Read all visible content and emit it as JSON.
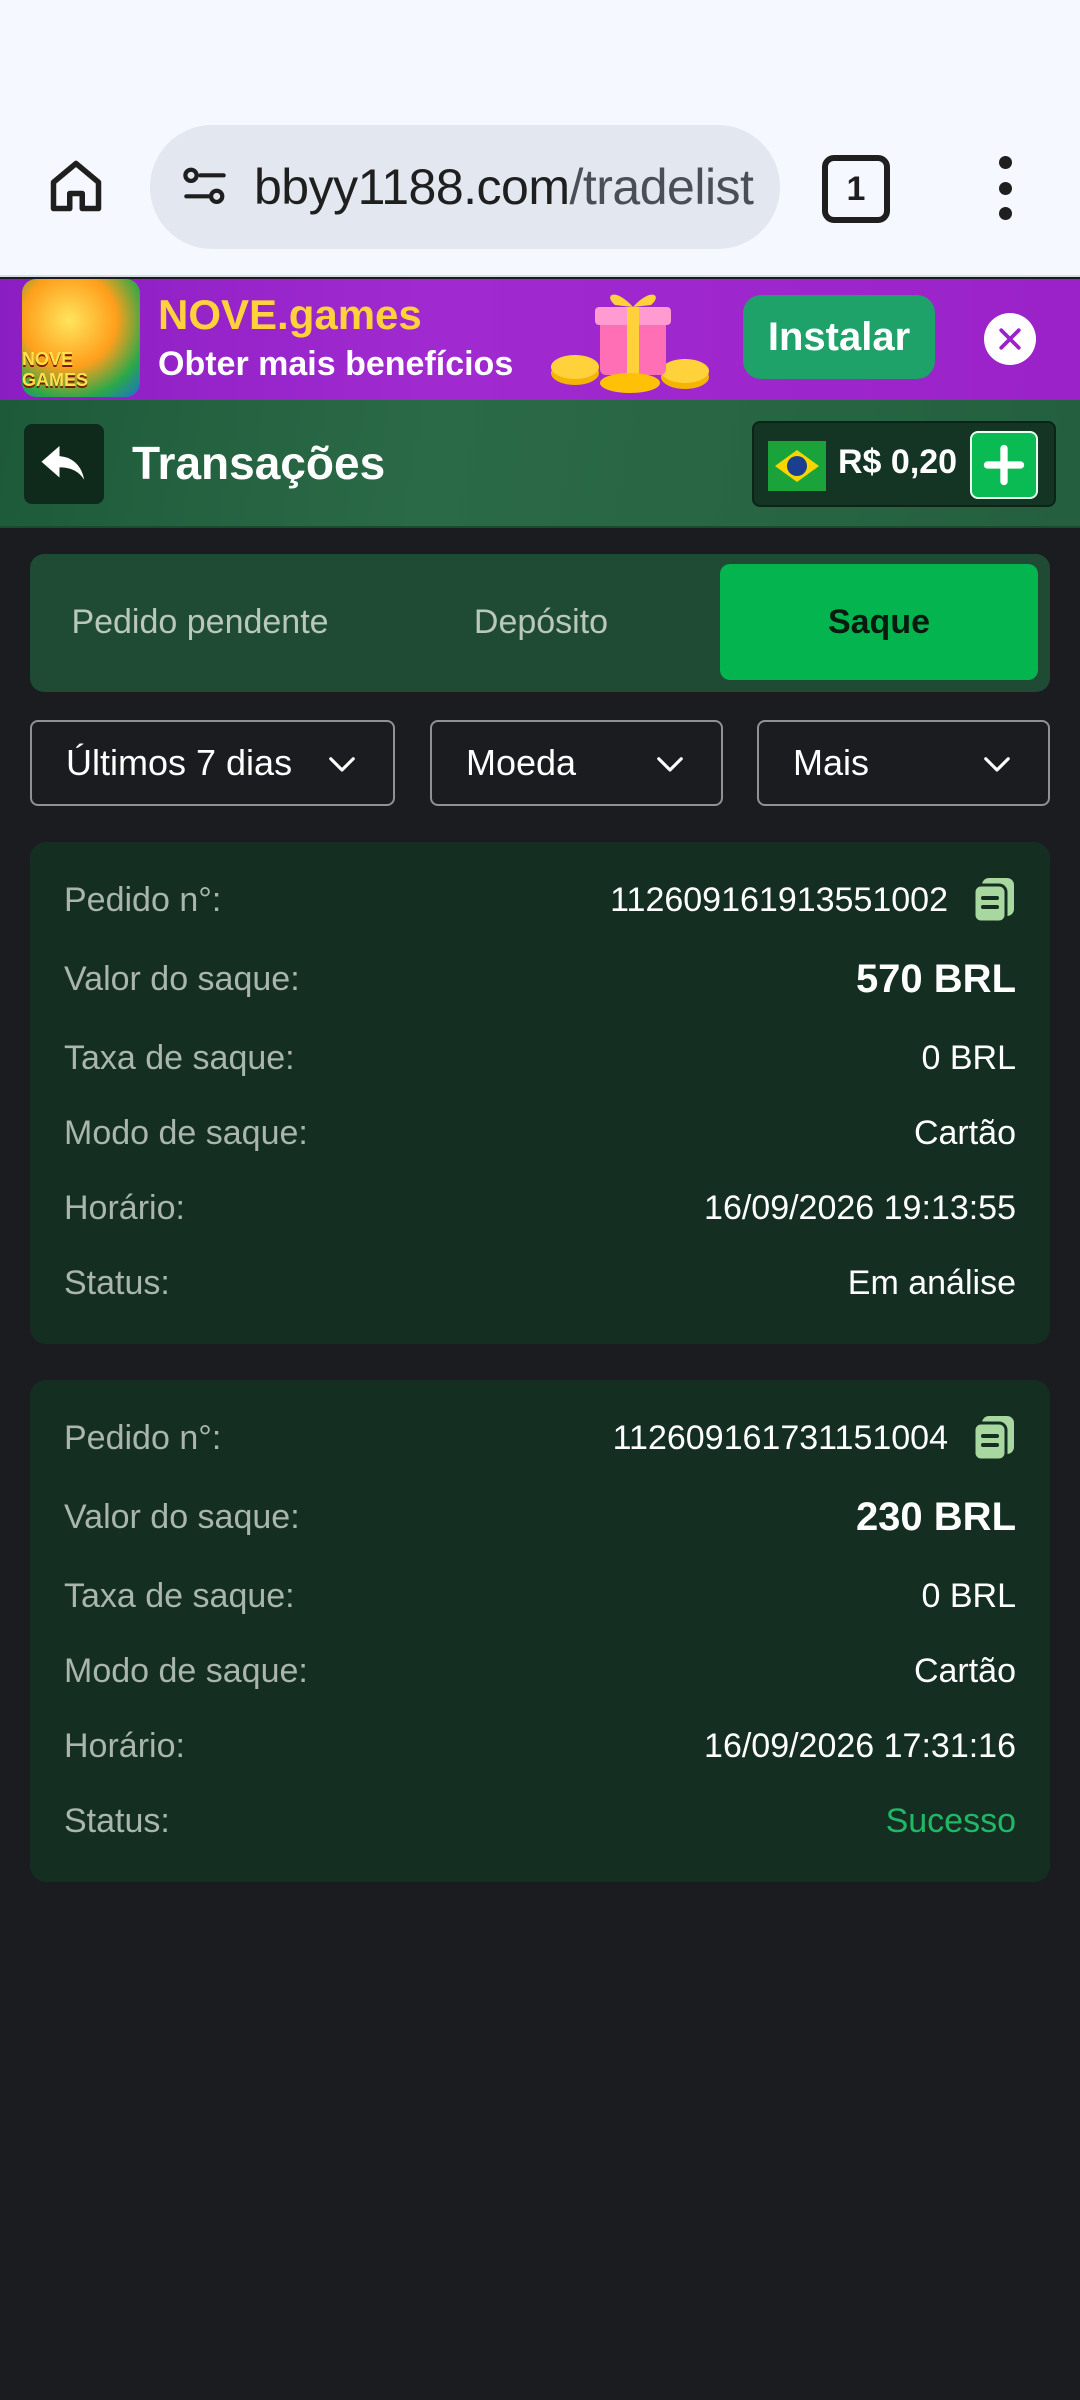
{
  "browser": {
    "url_domain": "bbyy1188.com",
    "url_path": "/tradelist",
    "tab_count": "1",
    "icons": [
      "home-icon",
      "tune-icon",
      "tabs-icon",
      "more-vert-icon"
    ]
  },
  "promo": {
    "logo_text": "NOVE GAMES",
    "title": "NOVE.games",
    "subtitle": "Obter mais benefícios",
    "install_label": "Instalar"
  },
  "header": {
    "title": "Transações",
    "balance": "R$ 0,20"
  },
  "tabs": [
    {
      "label": "Pedido pendente",
      "active": false
    },
    {
      "label": "Depósito",
      "active": false
    },
    {
      "label": "Saque",
      "active": true
    }
  ],
  "filters": {
    "period": "Últimos 7 dias",
    "currency": "Moeda",
    "more": "Mais"
  },
  "labels": {
    "order": "Pedido n°:",
    "amount": "Valor do saque:",
    "fee": "Taxa de saque:",
    "mode": "Modo de saque:",
    "time": "Horário:",
    "status": "Status:"
  },
  "transactions": [
    {
      "order_no": "112609161913551002",
      "amount": "570 BRL",
      "fee": "0 BRL",
      "mode": "Cartão",
      "time": "16/09/2026 19:13:55",
      "status": "Em análise"
    },
    {
      "order_no": "112609161731151004",
      "amount": "230 BRL",
      "fee": "0 BRL",
      "mode": "Cartão",
      "time": "16/09/2026 17:31:16",
      "status": "Sucesso"
    }
  ],
  "colors": {
    "accent_green": "#04b54f",
    "success_text": "#20b866",
    "card_bg": "#142e22",
    "promo_bg": "#9a22c8"
  }
}
